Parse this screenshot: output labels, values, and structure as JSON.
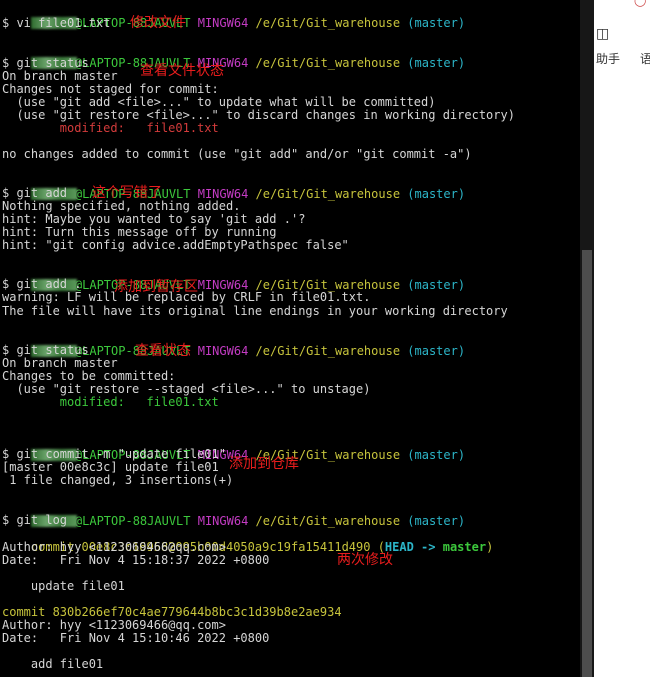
{
  "prompt": {
    "host": "@LAPTOP-88JAUVLT",
    "shell": "MINGW64",
    "path": "/e/Git/Git_warehouse",
    "branch": "(master)"
  },
  "lines": {
    "l1": "$ vi file01.txt",
    "l3": "$ git status",
    "l4": "On branch master",
    "l5": "Changes not staged for commit:",
    "l6": "  (use \"git add <file>...\" to update what will be committed)",
    "l7": "  (use \"git restore <file>...\" to discard changes in working directory)",
    "l8": "        modified:   file01.txt",
    "l9": "no changes added to commit (use \"git add\" and/or \"git commit -a\")",
    "l11": "$ git add",
    "l12": "Nothing specified, nothing added.",
    "l13": "hint: Maybe you wanted to say 'git add .'?",
    "l14": "hint: Turn this message off by running",
    "l15": "hint: \"git config advice.addEmptyPathspec false\"",
    "l17": "$ git add .",
    "l18": "warning: LF will be replaced by CRLF in file01.txt.",
    "l19": "The file will have its original line endings in your working directory",
    "l21": "$ git status",
    "l22": "On branch master",
    "l23": "Changes to be committed:",
    "l24": "  (use \"git restore --staged <file>...\" to unstage)",
    "l25": "        modified:   file01.txt",
    "l27": "$ git commit -m \"update file01\"",
    "l28": "[master 00e8c3c] update file01",
    "l29": " 1 file changed, 3 insertions(+)",
    "l31": "$ git log",
    "l32a": "commit 00e8c3c169582095b00d4050a9c19fa15411d490 ",
    "l32b": "(",
    "l32c": "HEAD -> ",
    "l32d": "master",
    "l32e": ")",
    "l33": "Author: hyy <1123069466@qq.com>",
    "l34": "Date:   Fri Nov 4 15:18:37 2022 +0800",
    "l35": "    update file01",
    "l36": "commit 830b266ef70c4ae779644b8bc3c1d39b8e2ae934",
    "l37": "Author: hyy <1123069466@qq.com>",
    "l38": "Date:   Fri Nov 4 15:10:46 2022 +0800",
    "l39": "    add file01"
  },
  "annotations": {
    "a1": "修改文件",
    "a2": "查看文件状态",
    "a3": "这个写错了",
    "a4": "添加到暂存区",
    "a5": "查看状态",
    "a6": "添加到仓库",
    "a7": "两次修改"
  },
  "right_panel": {
    "item1": "助手",
    "item2": "语"
  },
  "colors": {
    "background": "#000000",
    "text": "#d6d6d6",
    "user_host": "#3cc83c",
    "shell": "#c43cc4",
    "path": "#c7c43c",
    "branch": "#2cb5c8",
    "modified": "#d33b3b",
    "annotation": "#e81d1d"
  }
}
